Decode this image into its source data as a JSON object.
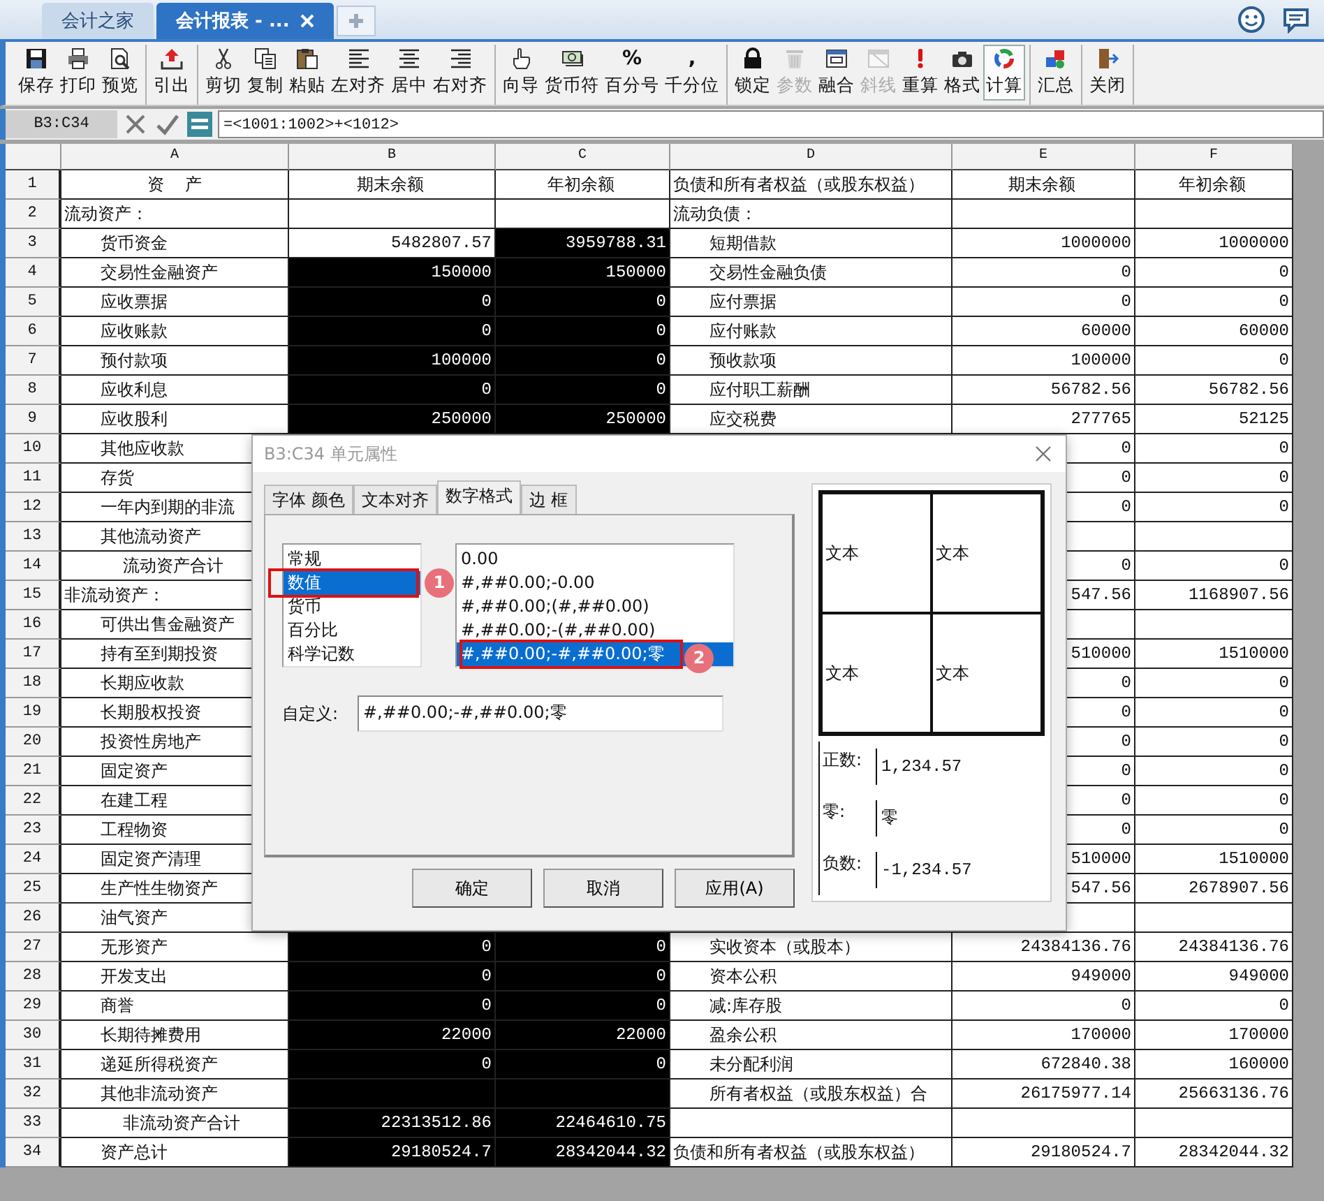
{
  "tabs": [
    {
      "label": "会计之家",
      "selected": false
    },
    {
      "label": "会计报表 - ...",
      "selected": true
    }
  ],
  "toolbar": [
    {
      "buttons": [
        {
          "label": "保存",
          "disabled": false,
          "pressed": false
        },
        {
          "label": "打印",
          "disabled": false,
          "pressed": false
        },
        {
          "label": "预览",
          "disabled": false,
          "pressed": false
        }
      ]
    },
    {
      "buttons": [
        {
          "label": "引出",
          "disabled": false,
          "pressed": false
        }
      ]
    },
    {
      "buttons": [
        {
          "label": "剪切",
          "disabled": false,
          "pressed": false
        },
        {
          "label": "复制",
          "disabled": false,
          "pressed": false
        },
        {
          "label": "粘贴",
          "disabled": false,
          "pressed": false
        },
        {
          "label": "左对齐",
          "disabled": false,
          "pressed": false
        },
        {
          "label": "居中",
          "disabled": false,
          "pressed": false
        },
        {
          "label": "右对齐",
          "disabled": false,
          "pressed": false
        }
      ]
    },
    {
      "buttons": [
        {
          "label": "向导",
          "disabled": false,
          "pressed": false
        },
        {
          "label": "货币符",
          "disabled": false,
          "pressed": false
        },
        {
          "label": "百分号",
          "glyph": "%",
          "disabled": false,
          "pressed": false
        },
        {
          "label": "千分位",
          "glyph": ",",
          "disabled": false,
          "pressed": false
        }
      ]
    },
    {
      "buttons": [
        {
          "label": "锁定",
          "disabled": false,
          "pressed": false
        },
        {
          "label": "参数",
          "disabled": true,
          "pressed": false
        },
        {
          "label": "融合",
          "disabled": false,
          "pressed": false
        },
        {
          "label": "斜线",
          "disabled": true,
          "pressed": false
        },
        {
          "label": "重算",
          "disabled": false,
          "pressed": false
        },
        {
          "label": "格式",
          "disabled": false,
          "pressed": false
        },
        {
          "label": "计算",
          "disabled": false,
          "pressed": true
        }
      ]
    },
    {
      "buttons": [
        {
          "label": "汇总",
          "disabled": false,
          "pressed": false
        }
      ]
    },
    {
      "buttons": [
        {
          "label": "关闭",
          "disabled": false,
          "pressed": false
        }
      ]
    }
  ],
  "formula_bar": {
    "cell_ref": "B3:C34",
    "formula": "=<1001:1002>+<1012>"
  },
  "columns": [
    "A",
    "B",
    "C",
    "D",
    "E",
    "F"
  ],
  "rows": [
    {
      "num": "1",
      "kind": "header",
      "a": {
        "text": "资    产",
        "kind": "header"
      },
      "b": {
        "text": "期末余额",
        "selected": false
      },
      "c": {
        "text": "年初余额",
        "selected": false
      },
      "d": {
        "text": "负债和所有者权益（或股东权益）",
        "kind": "group"
      },
      "e": "期末余额",
      "f": "年初余额"
    },
    {
      "num": "2",
      "kind": "data",
      "a": {
        "text": "流动资产：",
        "kind": "group"
      },
      "b": {
        "selected": false
      },
      "c": {
        "selected": false
      },
      "d": {
        "text": "流动负债：",
        "kind": "group"
      }
    },
    {
      "num": "3",
      "kind": "data",
      "a": {
        "text": "货币资金",
        "kind": "item"
      },
      "b": {
        "text": "5482807.57",
        "selected": false
      },
      "c": {
        "text": "3959788.31",
        "selected": true
      },
      "d": {
        "text": "短期借款",
        "kind": "item"
      },
      "e": "1000000",
      "f": "1000000"
    },
    {
      "num": "4",
      "kind": "data",
      "a": {
        "text": "交易性金融资产",
        "kind": "item"
      },
      "b": {
        "text": "150000",
        "selected": true
      },
      "c": {
        "text": "150000",
        "selected": true
      },
      "d": {
        "text": "交易性金融负债",
        "kind": "item"
      },
      "e": "0",
      "f": "0"
    },
    {
      "num": "5",
      "kind": "data",
      "a": {
        "text": "应收票据",
        "kind": "item"
      },
      "b": {
        "text": "0",
        "selected": true
      },
      "c": {
        "text": "0",
        "selected": true
      },
      "d": {
        "text": "应付票据",
        "kind": "item"
      },
      "e": "0",
      "f": "0"
    },
    {
      "num": "6",
      "kind": "data",
      "a": {
        "text": "应收账款",
        "kind": "item"
      },
      "b": {
        "text": "0",
        "selected": true
      },
      "c": {
        "text": "0",
        "selected": true
      },
      "d": {
        "text": "应付账款",
        "kind": "item"
      },
      "e": "60000",
      "f": "60000"
    },
    {
      "num": "7",
      "kind": "data",
      "a": {
        "text": "预付款项",
        "kind": "item"
      },
      "b": {
        "text": "100000",
        "selected": true
      },
      "c": {
        "text": "0",
        "selected": true
      },
      "d": {
        "text": "预收款项",
        "kind": "item"
      },
      "e": "100000",
      "f": "0"
    },
    {
      "num": "8",
      "kind": "data",
      "a": {
        "text": "应收利息",
        "kind": "item"
      },
      "b": {
        "text": "0",
        "selected": true
      },
      "c": {
        "text": "0",
        "selected": true
      },
      "d": {
        "text": "应付职工薪酬",
        "kind": "item"
      },
      "e": "56782.56",
      "f": "56782.56"
    },
    {
      "num": "9",
      "kind": "data",
      "a": {
        "text": "应收股利",
        "kind": "item"
      },
      "b": {
        "text": "250000",
        "selected": true
      },
      "c": {
        "text": "250000",
        "selected": true
      },
      "d": {
        "text": "应交税费",
        "kind": "item"
      },
      "e": "277765",
      "f": "52125"
    },
    {
      "num": "10",
      "kind": "data",
      "a": {
        "text": "其他应收款",
        "kind": "item"
      },
      "e": "0",
      "f": "0"
    },
    {
      "num": "11",
      "kind": "data",
      "a": {
        "text": "存货",
        "kind": "item"
      },
      "e": "0",
      "f": "0"
    },
    {
      "num": "12",
      "kind": "data",
      "a": {
        "text": "一年内到期的非流",
        "kind": "item"
      },
      "e": "0",
      "f": "0"
    },
    {
      "num": "13",
      "kind": "data",
      "a": {
        "text": "其他流动资产",
        "kind": "item"
      }
    },
    {
      "num": "14",
      "kind": "data",
      "a": {
        "text": "流动资产合计",
        "kind": "subtotal"
      },
      "e": "0",
      "f": "0"
    },
    {
      "num": "15",
      "kind": "data",
      "a": {
        "text": "非流动资产：",
        "kind": "group"
      },
      "e": "547.56",
      "f": "1168907.56"
    },
    {
      "num": "16",
      "kind": "data",
      "a": {
        "text": "可供出售金融资产",
        "kind": "item"
      }
    },
    {
      "num": "17",
      "kind": "data",
      "a": {
        "text": "持有至到期投资",
        "kind": "item"
      },
      "e": "510000",
      "f": "1510000"
    },
    {
      "num": "18",
      "kind": "data",
      "a": {
        "text": "长期应收款",
        "kind": "item"
      },
      "e": "0",
      "f": "0"
    },
    {
      "num": "19",
      "kind": "data",
      "a": {
        "text": "长期股权投资",
        "kind": "item"
      },
      "e": "0",
      "f": "0"
    },
    {
      "num": "20",
      "kind": "data",
      "a": {
        "text": "投资性房地产",
        "kind": "item"
      },
      "e": "0",
      "f": "0"
    },
    {
      "num": "21",
      "kind": "data",
      "a": {
        "text": "固定资产",
        "kind": "item"
      },
      "e": "0",
      "f": "0"
    },
    {
      "num": "22",
      "kind": "data",
      "a": {
        "text": "在建工程",
        "kind": "item"
      },
      "e": "0",
      "f": "0"
    },
    {
      "num": "23",
      "kind": "data",
      "a": {
        "text": "工程物资",
        "kind": "item"
      },
      "e": "0",
      "f": "0"
    },
    {
      "num": "24",
      "kind": "data",
      "a": {
        "text": "固定资产清理",
        "kind": "item"
      },
      "e": "510000",
      "f": "1510000"
    },
    {
      "num": "25",
      "kind": "data",
      "a": {
        "text": "生产性生物资产",
        "kind": "item"
      },
      "e": "547.56",
      "f": "2678907.56"
    },
    {
      "num": "26",
      "kind": "data",
      "a": {
        "text": "油气资产",
        "kind": "item"
      }
    },
    {
      "num": "27",
      "kind": "data",
      "a": {
        "text": "无形资产",
        "kind": "item"
      },
      "b": {
        "text": "0",
        "selected": true
      },
      "c": {
        "text": "0",
        "selected": true
      },
      "d": {
        "text": "实收资本（或股本）",
        "kind": "item"
      },
      "e": "24384136.76",
      "f": "24384136.76"
    },
    {
      "num": "28",
      "kind": "data",
      "a": {
        "text": "开发支出",
        "kind": "item"
      },
      "b": {
        "text": "0",
        "selected": true
      },
      "c": {
        "text": "0",
        "selected": true
      },
      "d": {
        "text": "资本公积",
        "kind": "item"
      },
      "e": "949000",
      "f": "949000"
    },
    {
      "num": "29",
      "kind": "data",
      "a": {
        "text": "商誉",
        "kind": "item"
      },
      "b": {
        "text": "0",
        "selected": true
      },
      "c": {
        "text": "0",
        "selected": true
      },
      "d": {
        "text": "减:库存股",
        "kind": "item"
      },
      "e": "0",
      "f": "0"
    },
    {
      "num": "30",
      "kind": "data",
      "a": {
        "text": "长期待摊费用",
        "kind": "item"
      },
      "b": {
        "text": "22000",
        "selected": true
      },
      "c": {
        "text": "22000",
        "selected": true
      },
      "d": {
        "text": "盈余公积",
        "kind": "item"
      },
      "e": "170000",
      "f": "170000"
    },
    {
      "num": "31",
      "kind": "data",
      "a": {
        "text": "递延所得税资产",
        "kind": "item"
      },
      "b": {
        "text": "0",
        "selected": true
      },
      "c": {
        "text": "0",
        "selected": true
      },
      "d": {
        "text": "未分配利润",
        "kind": "item"
      },
      "e": "672840.38",
      "f": "160000"
    },
    {
      "num": "32",
      "kind": "data",
      "a": {
        "text": "其他非流动资产",
        "kind": "item"
      },
      "b": {
        "selected": true
      },
      "c": {
        "selected": true
      },
      "d": {
        "text": "所有者权益（或股东权益）合",
        "kind": "item"
      },
      "e": "26175977.14",
      "f": "25663136.76"
    },
    {
      "num": "33",
      "kind": "data",
      "a": {
        "text": "非流动资产合计",
        "kind": "subtotal"
      },
      "b": {
        "text": "22313512.86",
        "selected": true
      },
      "c": {
        "text": "22464610.75",
        "selected": true
      },
      "d": {
        "kind": "item"
      }
    },
    {
      "num": "34",
      "kind": "data",
      "a": {
        "text": "资产总计",
        "kind": "item"
      },
      "b": {
        "text": "29180524.7",
        "selected": true
      },
      "c": {
        "text": "28342044.32",
        "selected": true
      },
      "d": {
        "text": "负债和所有者权益（或股东权益）",
        "kind": "group"
      },
      "e": "29180524.7",
      "f": "28342044.32"
    }
  ],
  "dialog": {
    "title": "B3:C34 单元属性",
    "tabs": [
      {
        "label": "字体 颜色",
        "selected": false
      },
      {
        "label": "文本对齐",
        "selected": false
      },
      {
        "label": "数字格式",
        "selected": true
      },
      {
        "label": "边 框",
        "selected": false
      }
    ],
    "categories": [
      {
        "label": "常规",
        "selected": false
      },
      {
        "label": "数值",
        "selected": true
      },
      {
        "label": "货币",
        "selected": false
      },
      {
        "label": "百分比",
        "selected": false
      },
      {
        "label": "科学记数",
        "selected": false
      }
    ],
    "category_callout": "1",
    "formats": [
      {
        "label": "0.00",
        "selected": false
      },
      {
        "label": "#,##0.00;-0.00",
        "selected": false
      },
      {
        "label": "#,##0.00;(#,##0.00)",
        "selected": false
      },
      {
        "label": "#,##0.00;-(#,##0.00)",
        "selected": false
      },
      {
        "label": "#,##0.00;-#,##0.00;零",
        "selected": true
      }
    ],
    "format_callout": "2",
    "custom_label": "自定义:",
    "custom_value": "#,##0.00;-#,##0.00;零",
    "preview_cells": [
      "文本",
      "文本",
      "文本",
      "文本"
    ],
    "samples": [
      {
        "label": "正数:",
        "value": "1,234.57"
      },
      {
        "label": "零:",
        "value": "零"
      },
      {
        "label": "负数:",
        "value": "-1,234.57"
      }
    ],
    "buttons": [
      "确定",
      "取消",
      "应用(A)"
    ]
  }
}
